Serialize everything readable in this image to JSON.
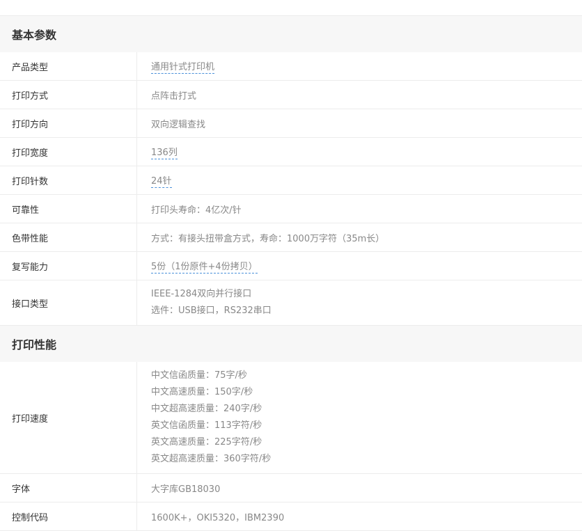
{
  "sections": [
    {
      "title": "基本参数",
      "rows": [
        {
          "label": "产品类型",
          "lines": [
            "通用针式打印机"
          ],
          "link": true
        },
        {
          "label": "打印方式",
          "lines": [
            "点阵击打式"
          ],
          "link": false
        },
        {
          "label": "打印方向",
          "lines": [
            "双向逻辑查找"
          ],
          "link": false
        },
        {
          "label": "打印宽度",
          "lines": [
            "136列"
          ],
          "link": true
        },
        {
          "label": "打印针数",
          "lines": [
            "24针"
          ],
          "link": true
        },
        {
          "label": "可靠性",
          "lines": [
            "打印头寿命：4亿次/针"
          ],
          "link": false
        },
        {
          "label": "色带性能",
          "lines": [
            "方式：有接头扭带盒方式，寿命：1000万字符（35m长）"
          ],
          "link": false
        },
        {
          "label": "复写能力",
          "lines": [
            "5份（1份原件+4份拷贝）"
          ],
          "link": true
        },
        {
          "label": "接口类型",
          "lines": [
            "IEEE-1284双向并行接口",
            "选件：USB接口，RS232串口"
          ],
          "link": false
        }
      ]
    },
    {
      "title": "打印性能",
      "rows": [
        {
          "label": "打印速度",
          "lines": [
            "中文信函质量：75字/秒",
            "中文高速质量：150字/秒",
            "中文超高速质量：240字/秒",
            "英文信函质量：113字符/秒",
            "英文高速质量：225字符/秒",
            "英文超高速质量：360字符/秒"
          ],
          "link": false
        },
        {
          "label": "字体",
          "lines": [
            "大字库GB18030"
          ],
          "link": false
        },
        {
          "label": "控制代码",
          "lines": [
            "1600K+，OKI5320，IBM2390"
          ],
          "link": false
        }
      ]
    }
  ]
}
